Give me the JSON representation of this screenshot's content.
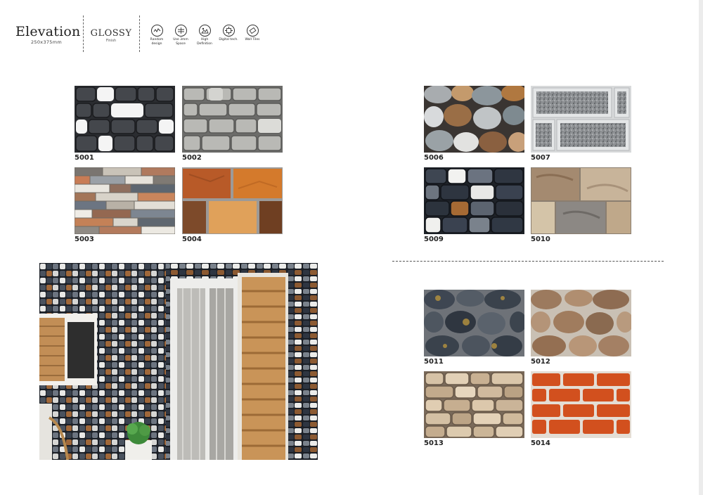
{
  "header": {
    "title": "Elevation",
    "size": "250x375mm",
    "finish": "GLOSSY",
    "finish_sub": "Finish",
    "features": [
      {
        "icon": "random-design-icon",
        "label": "Random design"
      },
      {
        "icon": "spacer-icon",
        "label": "Use 3mm Space"
      },
      {
        "icon": "high-definition-icon",
        "label": "High Definition"
      },
      {
        "icon": "digital-tech-icon",
        "label": "Digital tech."
      },
      {
        "icon": "wall-tiles-icon",
        "label": "Wall Tiles"
      }
    ]
  },
  "tiles": [
    {
      "code": "5001",
      "style": "black-white-stone"
    },
    {
      "code": "5002",
      "style": "grey-brick"
    },
    {
      "code": "5003",
      "style": "mixed-slate"
    },
    {
      "code": "5004",
      "style": "orange-brown-stone"
    },
    {
      "code": "5006",
      "style": "river-pebble"
    },
    {
      "code": "5007",
      "style": "grey-granite-panel"
    },
    {
      "code": "5009",
      "style": "dark-multicolor-stone"
    },
    {
      "code": "5010",
      "style": "beige-rough-stone"
    },
    {
      "code": "5011",
      "style": "dark-rubble"
    },
    {
      "code": "5012",
      "style": "brown-rubble"
    },
    {
      "code": "5013",
      "style": "beige-brick"
    },
    {
      "code": "5014",
      "style": "red-brick"
    }
  ],
  "colors": {
    "text": "#222222",
    "divider": "#555555"
  }
}
